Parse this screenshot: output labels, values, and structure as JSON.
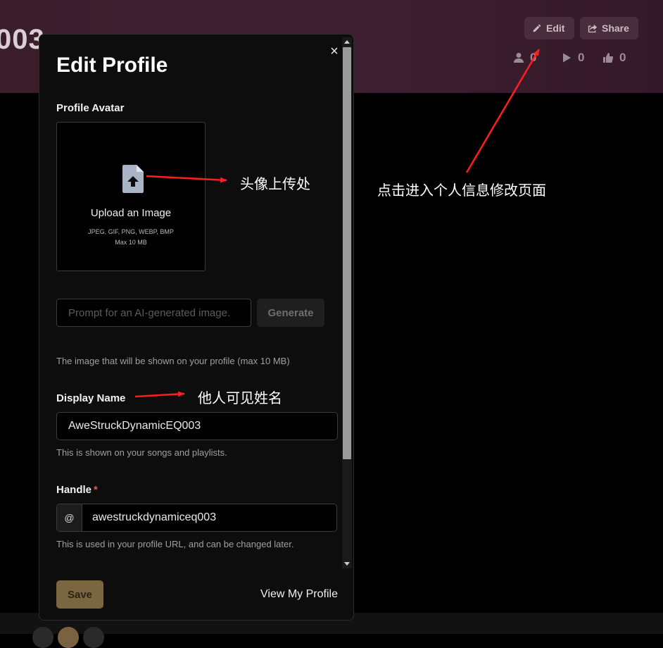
{
  "background": {
    "page_title_fragment": "003",
    "edit_label": "Edit",
    "share_label": "Share",
    "stats": {
      "followers": "0",
      "plays": "0",
      "likes": "0"
    }
  },
  "modal": {
    "title": "Edit Profile",
    "close_symbol": "×",
    "avatar": {
      "label": "Profile Avatar",
      "upload_title": "Upload an Image",
      "formats": "JPEG, GIF, PNG, WEBP, BMP",
      "max_size": "Max 10 MB"
    },
    "prompt": {
      "placeholder": "Prompt for an AI-generated image.",
      "value": "",
      "generate_label": "Generate"
    },
    "image_hint": "The image that will be shown on your profile (max 10 MB)",
    "display_name": {
      "label": "Display Name",
      "value": "AweStruckDynamicEQ003",
      "hint": "This is shown on your songs and playlists."
    },
    "handle": {
      "label": "Handle",
      "required_mark": "*",
      "prefix": "@",
      "value": "awestruckdynamiceq003",
      "hint": "This is used in your profile URL, and can be changed later."
    },
    "save_label": "Save",
    "view_profile_label": "View My Profile"
  },
  "annotations": {
    "avatar_upload": "头像上传处",
    "display_name": "他人可见姓名",
    "edit_entry": "点击进入个人信息修改页面"
  },
  "colors": {
    "header_band": "#3a1e2c",
    "accent_gold": "#7a6640",
    "annotation_arrow": "#ff1e1e",
    "required": "#e05a55"
  },
  "icons": [
    "pencil-icon",
    "share-icon",
    "person-icon",
    "play-icon",
    "thumbs-up-icon",
    "close-icon",
    "file-upload-icon"
  ]
}
